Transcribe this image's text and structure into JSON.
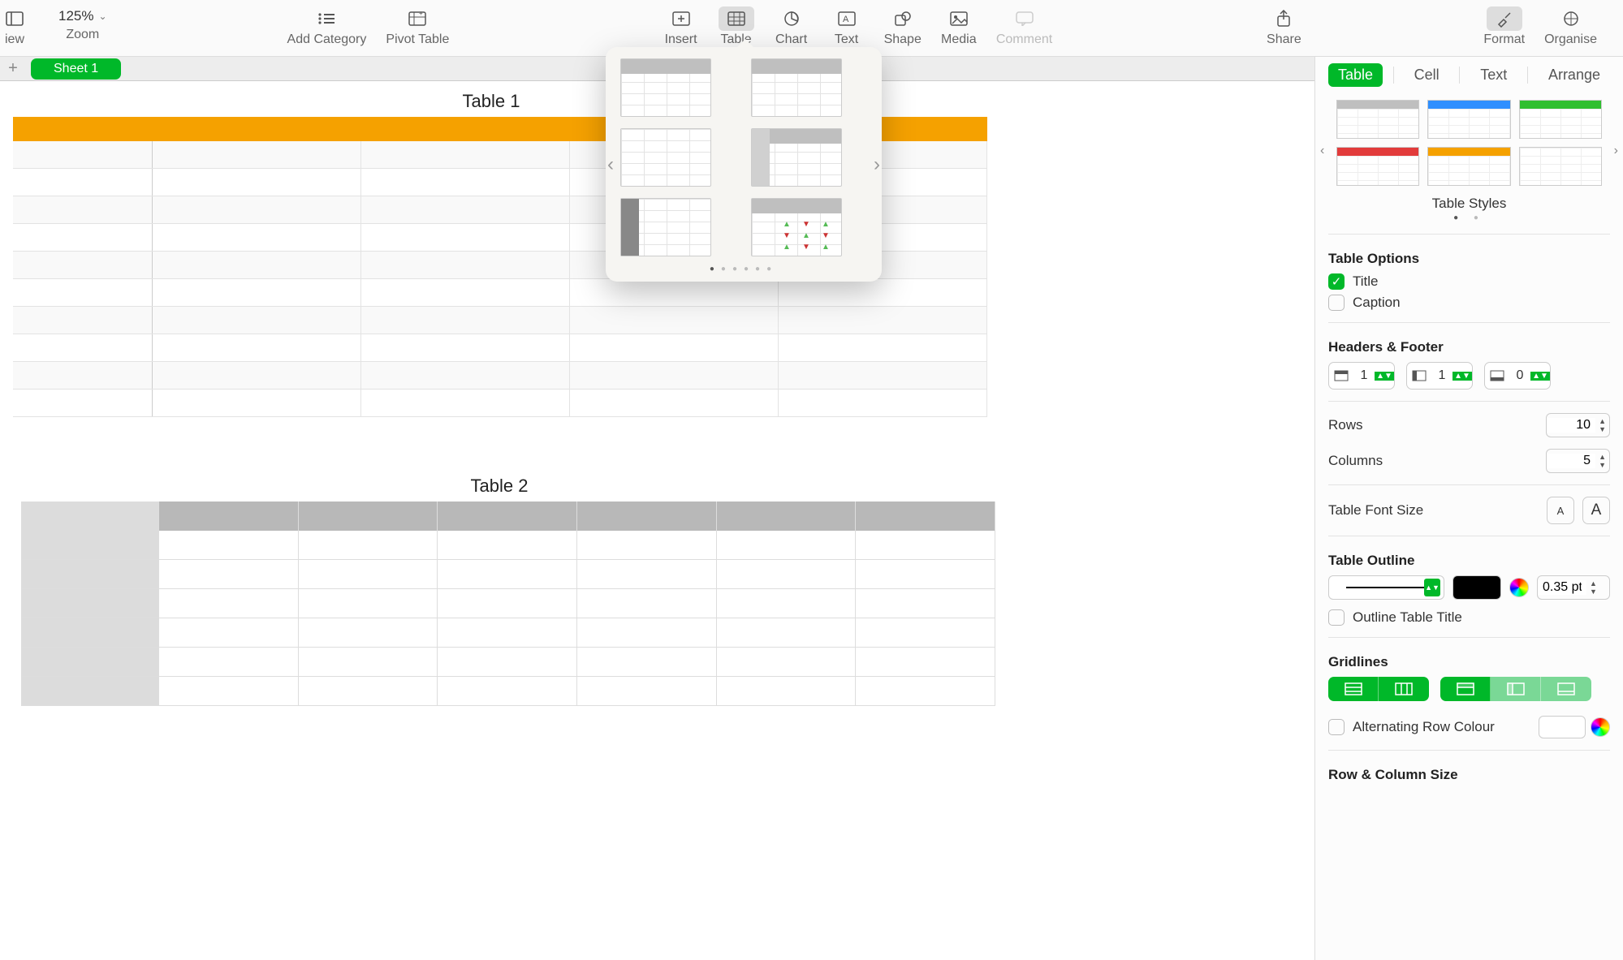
{
  "toolbar": {
    "view": "iew",
    "zoom_value": "125%",
    "zoom_label": "Zoom",
    "add_category": "Add Category",
    "pivot_table": "Pivot Table",
    "insert": "Insert",
    "table": "Table",
    "chart": "Chart",
    "text": "Text",
    "shape": "Shape",
    "media": "Media",
    "comment": "Comment",
    "share": "Share",
    "format": "Format",
    "organise": "Organise"
  },
  "sheet_tab": "Sheet 1",
  "canvas": {
    "table1_title": "Table 1",
    "table2_title": "Table 2"
  },
  "popover": {
    "styles": [
      "header-gray",
      "header-side",
      "plain",
      "both",
      "side-dark",
      "arrows"
    ]
  },
  "inspector": {
    "tabs": {
      "table": "Table",
      "cell": "Cell",
      "text": "Text",
      "arrange": "Arrange"
    },
    "styles_label": "Table Styles",
    "style_colors": [
      "#bfbfbf",
      "#2f8fff",
      "#2fbf2f",
      "#e23b3b",
      "#f5a100",
      "#ffffff"
    ],
    "options_title": "Table Options",
    "title_label": "Title",
    "caption_label": "Caption",
    "title_checked": true,
    "caption_checked": false,
    "hf_title": "Headers & Footer",
    "hf_header_rows": "1",
    "hf_header_cols": "1",
    "hf_footer_rows": "0",
    "rows_label": "Rows",
    "rows_val": "10",
    "cols_label": "Columns",
    "cols_val": "5",
    "font_size_label": "Table Font Size",
    "outline_title": "Table Outline",
    "outline_width": "0.35 pt",
    "outline_title_chk": "Outline Table Title",
    "gridlines_title": "Gridlines",
    "alt_row_label": "Alternating Row Colour",
    "rc_size_title": "Row & Column Size"
  }
}
